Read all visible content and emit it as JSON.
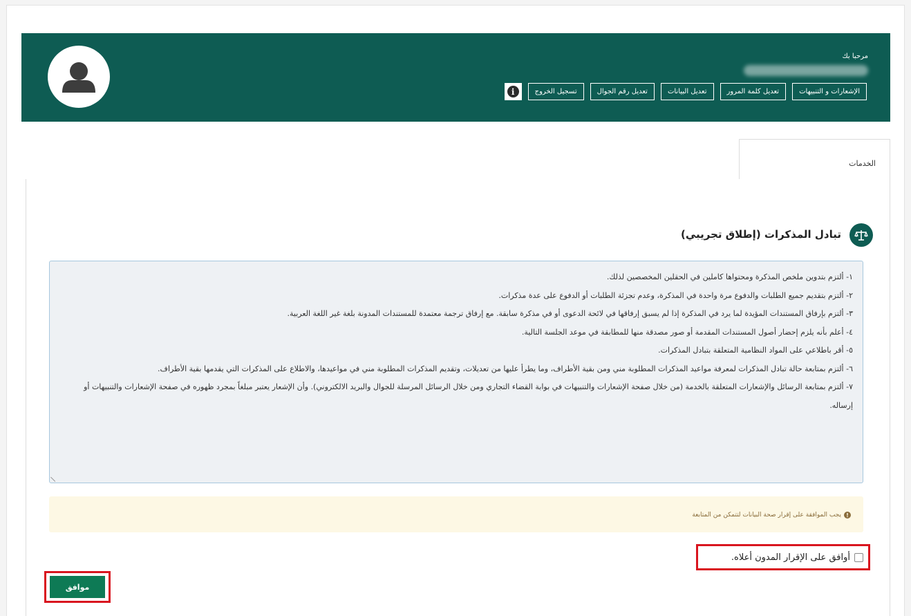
{
  "header": {
    "welcome": "مرحبا بك",
    "nav": [
      {
        "label": "الإشعارات و التنبيهات"
      },
      {
        "label": "تعديل كلمة المرور"
      },
      {
        "label": "تعديل البيانات"
      },
      {
        "label": "تعديل رقم الجوال"
      },
      {
        "label": "تسجيل الخروج"
      }
    ],
    "info_icon": "info-icon",
    "avatar_icon": "user-icon"
  },
  "tabs": [
    {
      "label": "الخدمات"
    }
  ],
  "section": {
    "icon": "scales-icon",
    "title": "تبادل المذكرات (إطلاق تجريبي)"
  },
  "terms": [
    "١- ألتزم بتدوين ملخص المذكرة ومحتواها كاملين في الحقلين المخصصين لذلك.",
    "٢- ألتزم بتقديم جميع الطلبات والدفوع مرة واحدة في المذكرة، وعدم تجزئة الطلبات أو الدفوع على عدة مذكرات.",
    "٣- ألتزم بإرفاق المستندات المؤيدة لما يرد في المذكرة إذا لم يسبق إرفاقها في لائحة الدعوى أو في مذكرة سابقة. مع إرفاق ترجمة معتمدة للمستندات المدونة بلغة غير اللغة العربية.",
    "٤- أعلم بأنه يلزم إحضار أصول المستندات المقدمة أو صور مصدقة منها للمطابقة في موعد الجلسة التالية.",
    "٥- أقر باطلاعي على المواد النظامية المتعلقة بتبادل المذكرات.",
    "٦- ألتزم بمتابعة حالة تبادل المذكرات لمعرفة مواعيد المذكرات المطلوبة مني ومن بقية الأطراف، وما يطرأ عليها من تعديلات، وتقديم المذكرات المطلوبة مني في مواعيدها، والاطلاع على المذكرات التي يقدمها بقية الأطراف.",
    "٧- ألتزم بمتابعة الرسائل والإشعارات المتعلقة بالخدمة (من خلال صفحة الإشعارات والتنبيهات في بوابة القضاء التجاري ومن خلال الرسائل المرسلة للجوال والبريد الالكتروني). وأن الإشعار يعتبر مبلغاً بمجرد ظهوره في صفحة الإشعارات والتنبيهات أو إرساله."
  ],
  "alert": {
    "icon": "exclamation-icon",
    "text": "يجب الموافقة على إقرار صحة البيانات لتتمكن من المتابعة"
  },
  "agreement": {
    "label": "أوافق على الإقرار المدون أعلاه.",
    "checked": false
  },
  "submit": {
    "label": "موافق"
  },
  "colors": {
    "header_bg": "#0e5c53",
    "button_bg": "#0e7a55",
    "highlight": "#d9151f",
    "alert_bg": "#fdf8e4",
    "alert_text": "#8a6d3b"
  }
}
